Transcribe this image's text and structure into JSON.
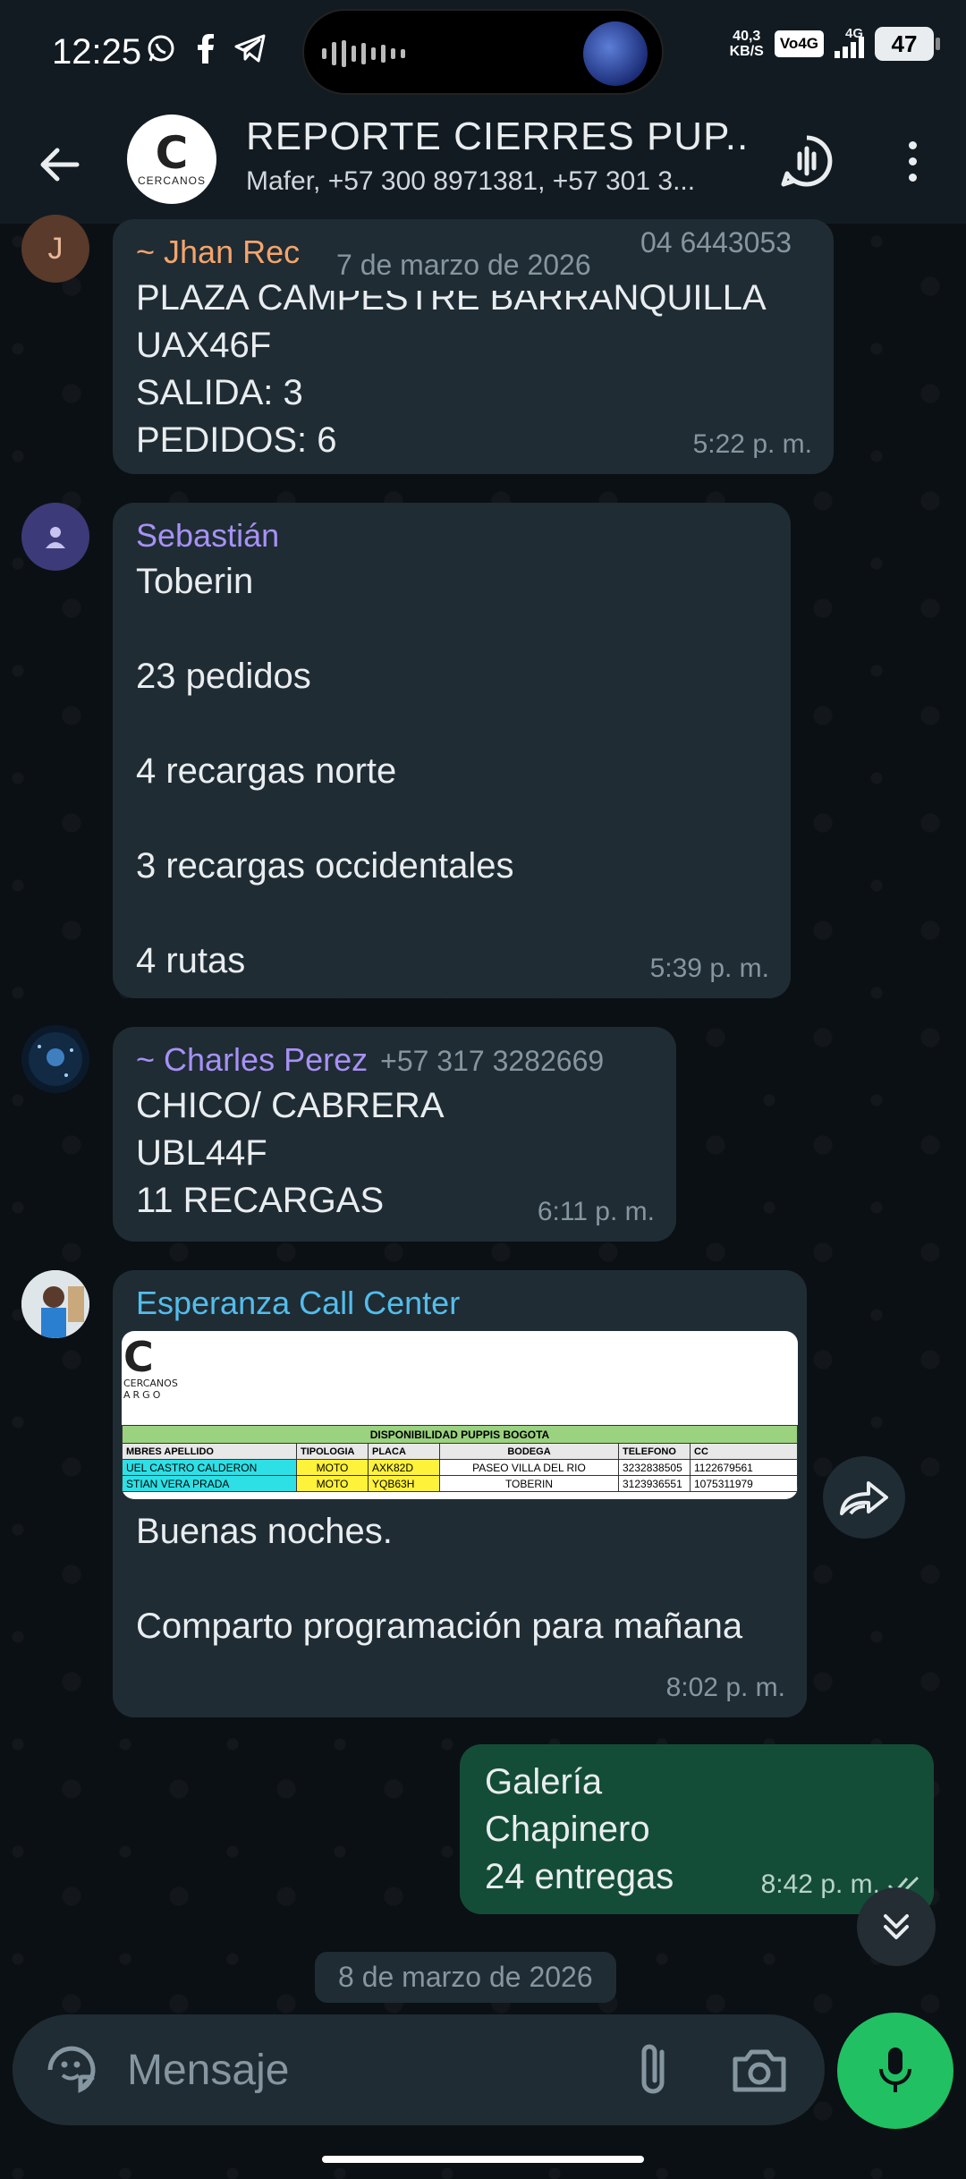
{
  "status_bar": {
    "time": "12:25",
    "apps": [
      "whatsapp-icon",
      "facebook-icon",
      "telegram-icon"
    ],
    "net_speed_value": "40,3",
    "net_speed_unit": "KB/S",
    "volte": "Vo4G",
    "network": "4G",
    "battery": "47"
  },
  "header": {
    "title": "REPORTE CIERRES PUP...",
    "subtitle": "Mafer, +57 300 8971381, +57 301 3...",
    "avatar_logo": "C",
    "avatar_text": "CERCANOS"
  },
  "messages": [
    {
      "sender": "~ Jhan Rec",
      "phone": "04 6443053",
      "sender_color": "#f5a46c",
      "avatar_letter": "J",
      "text": "PLAZA CAMPESTRE BARRANQUILLA\nUAX46F\nSALIDA: 3\nPEDIDOS: 6",
      "time": "5:22 p. m."
    },
    {
      "sender": "Sebastián",
      "sender_color": "#a791f5",
      "text": "Toberin\n\n23 pedidos\n\n4 recargas norte\n\n3 recargas occidentales\n\n4 rutas",
      "time": "5:39 p. m."
    },
    {
      "sender": "~ Charles Perez",
      "phone": "+57 317 3282669",
      "sender_color": "#a791f5",
      "text": "CHICO/ CABRERA\nUBL44F\n11 RECARGAS",
      "time": "6:11 p. m."
    },
    {
      "sender": "Esperanza Call Center",
      "sender_color": "#53bdeb",
      "text": "Buenas noches.\n\nComparto programación para mañana",
      "time": "8:02 p. m."
    },
    {
      "text": "Galería\nChapinero\n24 entregas",
      "time": "8:42 p. m."
    }
  ],
  "image_attachment": {
    "logo": "C",
    "logo_sub": "CERCANOS",
    "logo_sub2": "ARGO",
    "table_title": "DISPONIBILIDAD PUPPIS BOGOTA",
    "headers": [
      "MBRES APELLIDO",
      "TIPOLOGIA",
      "PLACA",
      "BODEGA",
      "TELEFONO",
      "CC"
    ],
    "rows": [
      [
        "UEL CASTRO CALDERON",
        "MOTO",
        "AXK82D",
        "PASEO VILLA DEL RIO",
        "3232838505",
        "1122679561"
      ],
      [
        "STIAN VERA PRADA",
        "MOTO",
        "YQB63H",
        "TOBERIN",
        "3123936551",
        "1075311979"
      ]
    ]
  },
  "date_chips": {
    "first": "7 de marzo de 2026",
    "second": "8 de marzo de 2026"
  },
  "input": {
    "placeholder": "Mensaje"
  },
  "colors": {
    "incoming_bubble": "#1f2c34",
    "outgoing_bubble": "#144d37",
    "accent_green": "#21c063"
  }
}
